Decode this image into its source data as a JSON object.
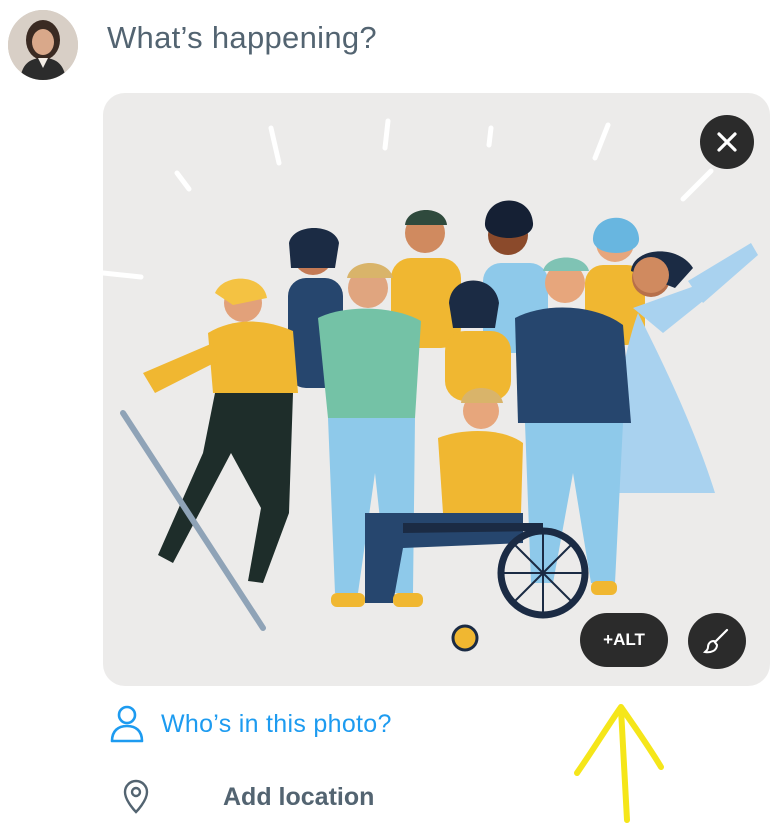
{
  "composer": {
    "placeholder": "What’s happening?"
  },
  "media": {
    "alt_button_label": "+ALT"
  },
  "actions": {
    "tag_people_label": "Who’s in this photo?",
    "location_label": "Add location"
  },
  "colors": {
    "accent": "#1d9bf0",
    "annotation_arrow": "#f5e61a",
    "overlay_button": "#2b2b2b"
  },
  "icons": {
    "close": "close-icon",
    "edit": "paintbrush-icon",
    "person": "person-icon",
    "location": "location-pin-icon"
  }
}
